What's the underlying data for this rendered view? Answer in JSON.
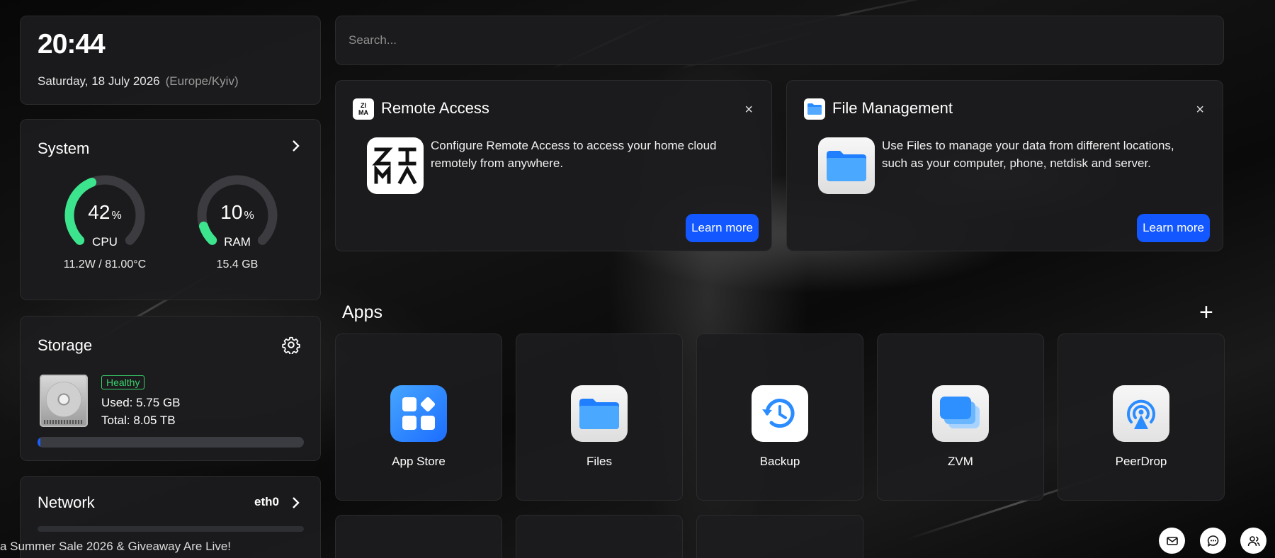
{
  "clock": {
    "time": "20:44",
    "date": "Saturday, 18 July 2026",
    "timezone": "(Europe/Kyiv)"
  },
  "system": {
    "title": "System",
    "cpu": {
      "value": "42",
      "unit": "%",
      "label": "CPU",
      "detail": "11.2W / 81.00°C",
      "percent": 42
    },
    "ram": {
      "value": "10",
      "unit": "%",
      "label": "RAM",
      "detail": "15.4 GB",
      "percent": 10
    }
  },
  "storage": {
    "title": "Storage",
    "status": "Healthy",
    "used": "Used: 5.75 GB",
    "total": "Total: 8.05 TB",
    "fill_percent": 1
  },
  "network": {
    "title": "Network",
    "interface": "eth0"
  },
  "search": {
    "placeholder": "Search..."
  },
  "cards": [
    {
      "title": "Remote Access",
      "description": "Configure Remote Access to access your home cloud remotely from anywhere.",
      "button": "Learn more",
      "close": "×",
      "logo_text": "ZIMA"
    },
    {
      "title": "File Management",
      "description": "Use Files to manage your data from different locations, such as your computer, phone, netdisk and server.",
      "button": "Learn more",
      "close": "×"
    }
  ],
  "apps": {
    "title": "Apps",
    "add": "+",
    "items": [
      {
        "name": "App Store",
        "icon": "app-store-icon"
      },
      {
        "name": "Files",
        "icon": "folder-icon"
      },
      {
        "name": "Backup",
        "icon": "backup-icon"
      },
      {
        "name": "ZVM",
        "icon": "zvm-icon"
      },
      {
        "name": "PeerDrop",
        "icon": "peerdrop-icon"
      }
    ]
  },
  "ticker": {
    "text": "a Summer Sale 2026 & Giveaway Are Live!"
  },
  "colors": {
    "accent": "#1257ff",
    "gauge_green": "#3be48d",
    "healthy": "#39d26b"
  }
}
